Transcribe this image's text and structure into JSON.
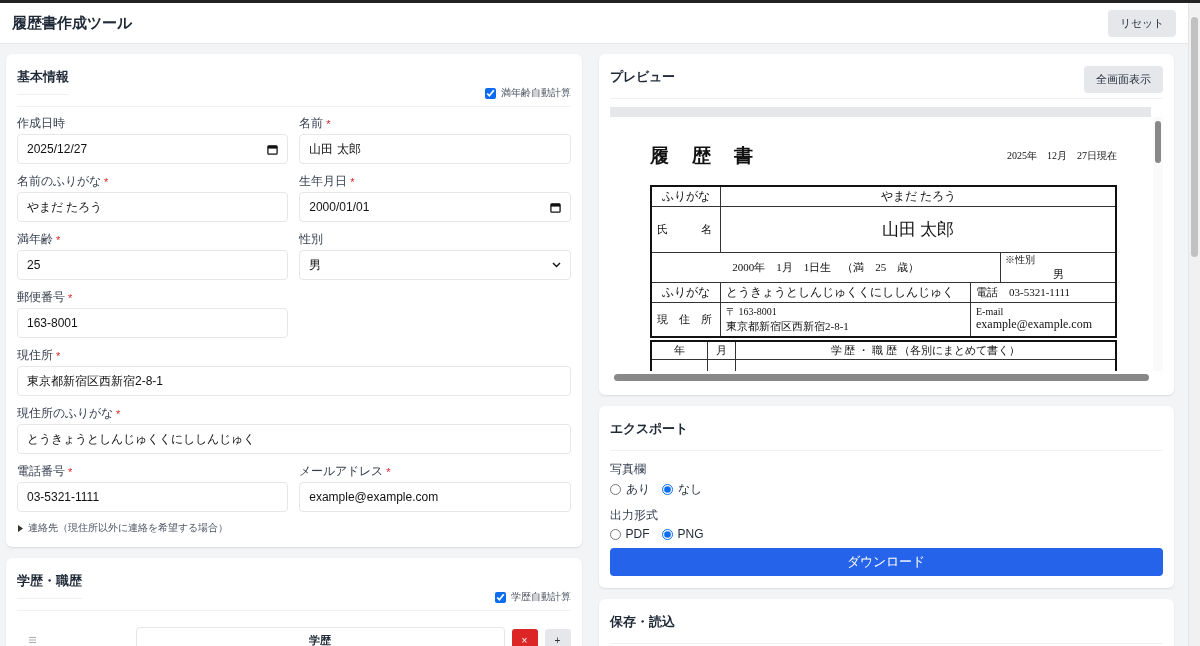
{
  "header": {
    "title": "履歴書作成ツール",
    "reset_button": "リセット"
  },
  "basic_info": {
    "title": "基本情報",
    "auto_age": {
      "label": "満年齢自動計算",
      "checked": true
    },
    "rows": [
      {
        "kind": "pair",
        "fields": [
          {
            "kind": "date",
            "label": "作成日時",
            "value": "2025/12/27"
          },
          {
            "kind": "text",
            "label": "名前",
            "required_mark": "*",
            "value": "山田 太郎"
          }
        ]
      },
      {
        "kind": "pair",
        "fields": [
          {
            "kind": "text",
            "label": "名前のふりがな",
            "required_mark": "*",
            "value": "やまだ たろう"
          },
          {
            "kind": "date",
            "label": "生年月日",
            "required_mark": "*",
            "value": "2000/01/01"
          }
        ]
      },
      {
        "kind": "pair",
        "fields": [
          {
            "kind": "text",
            "label": "満年齢",
            "required_mark": "*",
            "value": "25"
          },
          {
            "kind": "select",
            "label": "性別",
            "value": "男"
          }
        ]
      },
      {
        "kind": "pair",
        "fields": [
          {
            "kind": "text",
            "label": "郵便番号",
            "required_mark": "*",
            "value": "163-8001"
          }
        ]
      },
      {
        "kind": "wide",
        "fields": [
          {
            "kind": "text",
            "label": "現住所",
            "required_mark": "*",
            "value": "東京都新宿区西新宿2-8-1"
          }
        ]
      },
      {
        "kind": "wide",
        "fields": [
          {
            "kind": "text",
            "label": "現住所のふりがな",
            "required_mark": "*",
            "value": "とうきょうとしんじゅくくにししんじゅく"
          }
        ]
      },
      {
        "kind": "pair",
        "fields": [
          {
            "kind": "text",
            "label": "電話番号",
            "required_mark": "*",
            "value": "03-5321-1111"
          },
          {
            "kind": "text",
            "label": "メールアドレス",
            "required_mark": "*",
            "value": "example@example.com"
          }
        ]
      }
    ],
    "contact_toggle": {
      "label": "連絡先（現住所以外に連絡を希望する場合）",
      "expanded": false
    }
  },
  "history": {
    "title": "学歴・職歴",
    "auto_history": {
      "label": "学歴自動計算",
      "checked": true
    },
    "rows": [
      {
        "value": "学歴",
        "delete_button": "×",
        "add_button": "+"
      }
    ]
  },
  "preview": {
    "title": "プレビュー",
    "fullscreen_button": "全画面表示",
    "document": {
      "heading": "履　歴　書",
      "date": "2025年　12月　27日現在",
      "furigana_label": "ふりがな",
      "furigana": "やまだ たろう",
      "name_label": "氏　　　名",
      "name": "山田 太郎",
      "birth": "2000年　1月　1日生　（満　25　歳）",
      "gender_label": "※性別",
      "gender": "男",
      "address_furigana_label": "ふりがな",
      "address_furigana": "とうきょうとしんじゅくくにししんじゅく",
      "phone_label": "電話",
      "phone": "03-5321-1111",
      "address_label": "現　住　所",
      "postal": "〒 163-8001",
      "address": "東京都新宿区西新宿2-8-1",
      "email_label": "E-mail",
      "email": "example@example.com",
      "history_headers": [
        "年",
        "月",
        "学 歴 ・ 職 歴 （各別にまとめて書く）"
      ]
    }
  },
  "export": {
    "title": "エクスポート",
    "groups": [
      {
        "label": "写真欄",
        "options": [
          {
            "label": "あり",
            "selected": false
          },
          {
            "label": "なし",
            "selected": true
          }
        ]
      },
      {
        "label": "出力形式",
        "options": [
          {
            "label": "PDF",
            "selected": false
          },
          {
            "label": "PNG",
            "selected": true
          }
        ]
      }
    ],
    "download_button": "ダウンロード"
  },
  "save_load": {
    "title": "保存・読込"
  }
}
